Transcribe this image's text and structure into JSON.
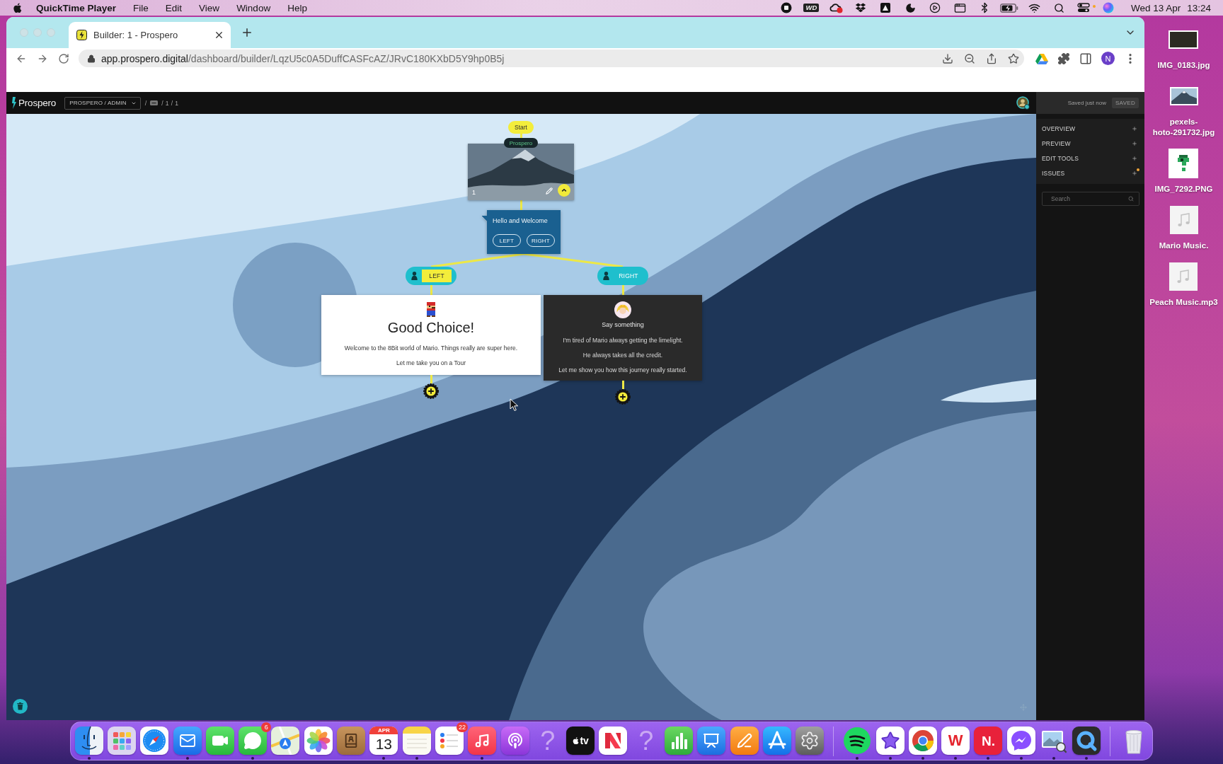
{
  "menu_bar": {
    "app_name": "QuickTime Player",
    "menus": [
      "File",
      "Edit",
      "View",
      "Window",
      "Help"
    ],
    "drive_badge": "WD",
    "date": "Wed 13 Apr",
    "time": "13:24"
  },
  "browser": {
    "tab": {
      "title": "Builder: 1 - Prospero",
      "selected": true
    },
    "url": {
      "host": "app.prospero.digital",
      "path": "/dashboard/builder/LqzU5c0A5DuffCASFcAZ/JRvC180KXbD5Y9hp0B5j"
    },
    "profile_initial": "N"
  },
  "app_bar": {
    "logo": "Prospero",
    "workspace": "PROSPERO / ADMIN",
    "separator": "/",
    "path": "/ 1 / 1"
  },
  "canvas": {
    "start": "Start",
    "image_node": {
      "badge": "Prospero",
      "number": "1"
    },
    "message_node": {
      "text": "Hello and Welcome",
      "choices": [
        "LEFT",
        "RIGHT"
      ]
    },
    "branches": [
      {
        "label": "LEFT",
        "selected": true,
        "card": {
          "kind": "light",
          "title": "Good Choice!",
          "paragraphs": [
            "Welcome to the 8Bit world of Mario. Things really are super here.",
            "Let me take you on a Tour"
          ]
        }
      },
      {
        "label": "RIGHT",
        "selected": false,
        "card": {
          "kind": "dark",
          "title": "Say something",
          "paragraphs": [
            "I'm tired of Mario always getting the limelight.",
            "He always takes all the credit.",
            "Let me show you how this journey really started."
          ]
        }
      }
    ]
  },
  "panel": {
    "status": "Saved just now",
    "save_button": {
      "label": "SAVED",
      "disabled": true
    },
    "sections": [
      {
        "label": "OVERVIEW",
        "alert": false
      },
      {
        "label": "PREVIEW",
        "alert": false
      },
      {
        "label": "EDIT TOOLS",
        "alert": false
      },
      {
        "label": "ISSUES",
        "alert": true
      }
    ],
    "search": {
      "placeholder": "Search"
    }
  },
  "desktop_files": [
    {
      "kind": "photo-dark",
      "label": "IMG_0183.jpg"
    },
    {
      "kind": "photo-mountain",
      "label": "pexels-\nhoto-291732.jpg"
    },
    {
      "kind": "pixel-image",
      "label": "IMG_7292.PNG"
    },
    {
      "kind": "audio",
      "label": "Mario Music."
    },
    {
      "kind": "audio",
      "label": "Peach Music.mp3"
    }
  ],
  "dock": {
    "groups": [
      [
        {
          "kind": "face",
          "running": true
        },
        {
          "kind": "grid",
          "running": false
        },
        {
          "kind": "compass",
          "running": false
        },
        {
          "kind": "envelope",
          "running": true
        },
        {
          "kind": "camera",
          "running": false
        },
        {
          "kind": "bubble",
          "running": true,
          "badge": "6"
        },
        {
          "kind": "map",
          "running": false
        },
        {
          "kind": "flower",
          "running": false
        },
        {
          "kind": "book",
          "running": false
        },
        {
          "kind": "calendar",
          "running": true,
          "month": "APR",
          "day": "13"
        },
        {
          "kind": "notepad",
          "running": true
        },
        {
          "kind": "checklist",
          "running": false,
          "badge": "22"
        },
        {
          "kind": "note",
          "running": true
        },
        {
          "kind": "podcast",
          "running": false
        },
        {
          "kind": "missing",
          "running": false,
          "glyph": "?"
        },
        {
          "kind": "tv",
          "running": false,
          "label": "tv"
        },
        {
          "kind": "ribbon",
          "running": false
        },
        {
          "kind": "missing",
          "running": false,
          "glyph": "?"
        },
        {
          "kind": "chart",
          "running": false
        },
        {
          "kind": "lectern",
          "running": false
        },
        {
          "kind": "pen",
          "running": false
        },
        {
          "kind": "tools",
          "running": false
        },
        {
          "kind": "gear",
          "running": false
        }
      ],
      [
        {
          "kind": "waves",
          "running": true
        },
        {
          "kind": "star",
          "running": true
        },
        {
          "kind": "ring",
          "running": true
        },
        {
          "kind": "letter-light",
          "running": true,
          "label": "W"
        },
        {
          "kind": "letter-red",
          "running": true,
          "label": "N."
        },
        {
          "kind": "bolt-bubble",
          "running": true
        },
        {
          "kind": "photo-stack",
          "running": true
        },
        {
          "kind": "q-ring",
          "running": true
        }
      ],
      [
        {
          "kind": "bin",
          "running": false
        }
      ]
    ]
  }
}
